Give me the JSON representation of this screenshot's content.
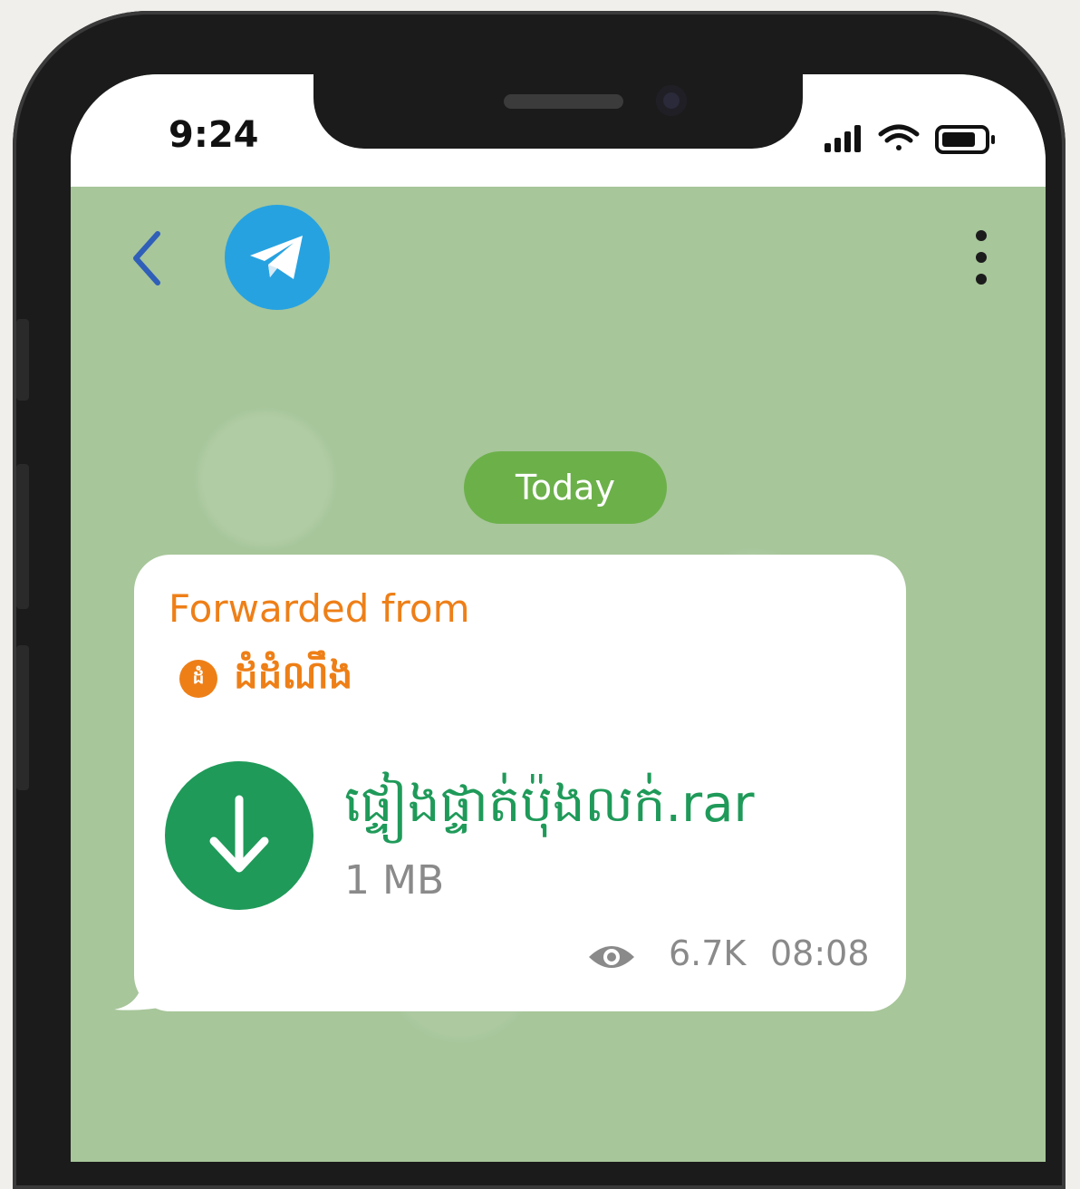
{
  "status_bar": {
    "time": "9:24"
  },
  "header": {
    "back_icon": "chevron-left-icon",
    "avatar_icon": "telegram-icon",
    "menu_icon": "more-vertical-icon"
  },
  "chat": {
    "date_separator": "Today",
    "message": {
      "forwarded_label": "Forwarded from",
      "forwarded_avatar_text": "ដំ",
      "forwarded_name": "ដំដំណឹង",
      "file": {
        "name": "ផ្ទៀងផ្ទាត់ប៉ុងលក់.rar",
        "size": "1 MB",
        "icon": "download-icon"
      },
      "views": "6.7K",
      "time": "08:08"
    }
  },
  "colors": {
    "chat_background": "#a7c69a",
    "date_pill": "#6cb04a",
    "forward_accent": "#ee7f17",
    "file_accent": "#1f9a59",
    "telegram_blue": "#27a2e0"
  }
}
